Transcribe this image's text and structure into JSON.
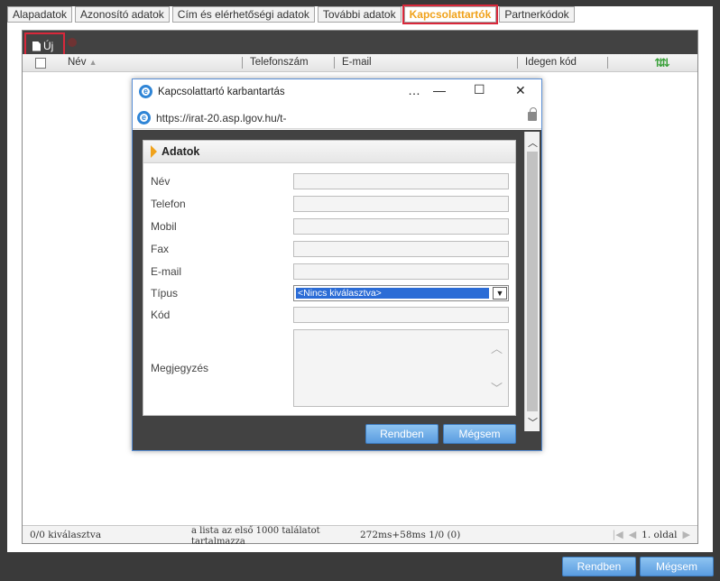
{
  "tabs": [
    {
      "label": "Alapadatok"
    },
    {
      "label": "Azonosító adatok"
    },
    {
      "label": "Cím és elérhetőségi adatok"
    },
    {
      "label": "További adatok"
    },
    {
      "label": "Kapcsolattartók",
      "active": true
    },
    {
      "label": "Partnerkódok"
    }
  ],
  "toolbar": {
    "new_label": "Új",
    "new_icon": "document-icon",
    "delete_icon": "delete-icon"
  },
  "grid": {
    "columns": [
      {
        "label": "Név",
        "sort": "asc"
      },
      {
        "label": "Telefonszám"
      },
      {
        "label": "E-mail"
      },
      {
        "label": "Idegen kód"
      }
    ],
    "refresh_icon": "refresh-icon"
  },
  "status": {
    "selected": "0/0 kiválasztva",
    "note": "a lista az első 1000 találatot tartalmazza",
    "timing": "272ms+58ms 1/0 (0)",
    "page": "1. oldal"
  },
  "footer": {
    "ok_label": "Rendben",
    "cancel_label": "Mégsem"
  },
  "dialog": {
    "title": "Kapcsolattartó karbantartás",
    "url": "https://irat-20.asp.lgov.hu/t-",
    "section": "Adatok",
    "fields": {
      "name": {
        "label": "Név",
        "value": ""
      },
      "phone": {
        "label": "Telefon",
        "value": ""
      },
      "mobile": {
        "label": "Mobil",
        "value": ""
      },
      "fax": {
        "label": "Fax",
        "value": ""
      },
      "email": {
        "label": "E-mail",
        "value": ""
      },
      "type": {
        "label": "Típus",
        "value": "<Nincs kiválasztva>"
      },
      "code": {
        "label": "Kód",
        "value": ""
      },
      "note": {
        "label": "Megjegyzés",
        "value": ""
      }
    },
    "ok_label": "Rendben",
    "cancel_label": "Mégsem"
  },
  "colors": {
    "accent": "#f0a21b",
    "highlight": "#d9283b",
    "button": "#5a9ce0",
    "dark": "#424242"
  }
}
